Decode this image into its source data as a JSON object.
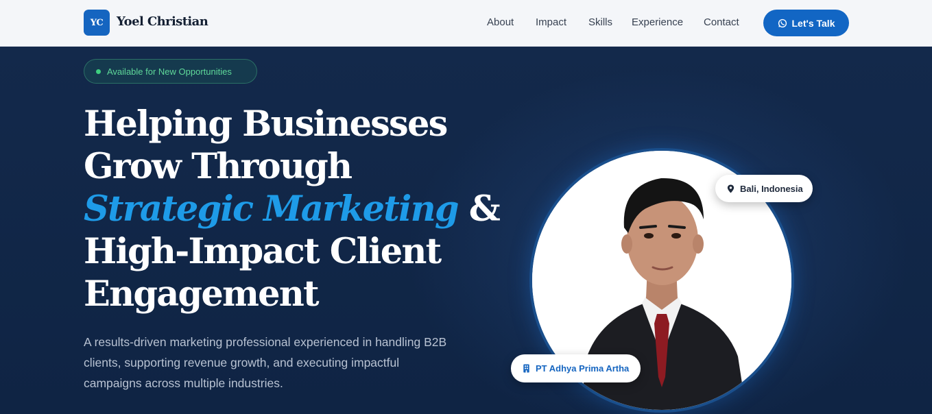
{
  "brand": {
    "initials": "YC",
    "name": "Yoel Christian"
  },
  "nav": {
    "links": [
      "About",
      "Impact",
      "Skills",
      "Experience",
      "Contact"
    ],
    "cta_label": "Let's Talk"
  },
  "hero": {
    "badge": "Available for New Opportunities",
    "headline": {
      "line1": "Helping Businesses",
      "line2": "Grow Through",
      "accent": "Strategic Marketing",
      "amp": " &",
      "line4": "High-Impact Client",
      "line5": "Engagement"
    },
    "subtext": "A results-driven marketing professional experienced in handling B2B clients, supporting revenue growth, and executing impactful campaigns across multiple industries.",
    "location_tag": "Bali, Indonesia",
    "company_tag": "PT Adhya Prima Artha"
  },
  "colors": {
    "accent": "#1e9be8",
    "brand": "#1266c4",
    "available": "#3ecf7f",
    "background": "#0f2444"
  },
  "icons": {
    "cta": "whatsapp-icon",
    "location": "map-pin-icon",
    "company": "building-icon"
  }
}
